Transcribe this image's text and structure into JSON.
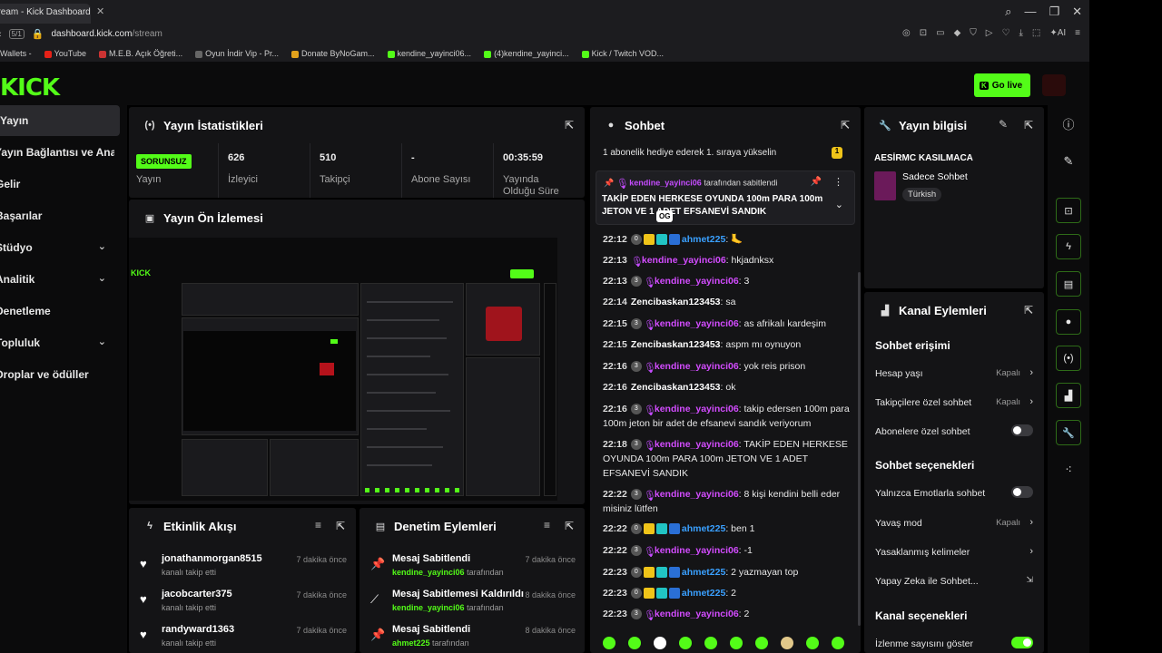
{
  "browser": {
    "tab_title": "Stream - Kick Dashboard",
    "url_host": "dashboard.kick.com",
    "url_path": "/stream",
    "bookmarks": [
      "Wallets -",
      "YouTube",
      "M.E.B. Açık Öğreti...",
      "Oyun İndir Vip - Pr...",
      "Donate ByNoGam...",
      "kendine_yayinci06...",
      "(4)kendine_yayinci...",
      "Kick / Twitch VOD..."
    ]
  },
  "header": {
    "logo": "KICK",
    "go_live_label": "Go live"
  },
  "sidebar": {
    "items": [
      {
        "label": "Yayın",
        "active": true
      },
      {
        "label": "Yayın Bağlantısı ve Anahtarı"
      },
      {
        "label": "Gelir"
      },
      {
        "label": "Başarılar"
      },
      {
        "label": "Stüdyo",
        "chevron": true
      },
      {
        "label": "Analitik",
        "chevron": true
      },
      {
        "label": "Denetleme"
      },
      {
        "label": "Topluluk",
        "chevron": true
      },
      {
        "label": "Droplar ve ödüller"
      }
    ]
  },
  "stats_panel": {
    "title": "Yayın İstatistikleri",
    "status_badge": "SORUNSUZ",
    "status_label": "Yayın",
    "viewers": {
      "value": "626",
      "label": "İzleyici"
    },
    "followers": {
      "value": "510",
      "label": "Takipçi"
    },
    "subs": {
      "value": "-",
      "label": "Abone Sayısı"
    },
    "duration": {
      "value": "00:35:59",
      "label": "Yayında Olduğu Süre"
    }
  },
  "preview_panel": {
    "title": "Yayın Ön İzlemesi"
  },
  "activity_panel": {
    "title": "Etkinlik Akışı",
    "items": [
      {
        "name": "jonathanmorgan8515",
        "action": "kanalı takip etti",
        "time": "7 dakika önce"
      },
      {
        "name": "jacobcarter375",
        "action": "kanalı takip etti",
        "time": "7 dakika önce"
      },
      {
        "name": "randyward1363",
        "action": "kanalı takip etti",
        "time": "7 dakika önce"
      }
    ]
  },
  "moderation_panel": {
    "title": "Denetim Eylemleri",
    "suffix": "tarafından",
    "items": [
      {
        "title": "Mesaj Sabitlendi",
        "by": "kendine_yayinci06",
        "time": "7 dakika önce"
      },
      {
        "title": "Mesaj Sabitlemesi Kaldırıldı",
        "by": "kendine_yayinci06",
        "time": "8 dakika önce"
      },
      {
        "title": "Mesaj Sabitlendi",
        "by": "ahmet225",
        "time": "8 dakika önce"
      }
    ]
  },
  "chat_panel": {
    "title": "Sohbet",
    "gift_text": "1 abonelik hediye ederek 1. sıraya yükselin",
    "gift_badge": "1",
    "pinned": {
      "by": "kendine_yayinci06",
      "by_suffix": "tarafından sabitlendi",
      "text": "TAKİP EDEN HERKESE OYUNDA 100m PARA 100m JETON VE 1 ADET EFSANEVİ SANDIK",
      "tooltip": "OG"
    },
    "messages": [
      {
        "time": "22:12",
        "user": "ahmet225",
        "color": "blue",
        "badges": true,
        "text": ""
      },
      {
        "time": "22:13",
        "user": "kendine_yayinci06",
        "color": "purple",
        "text": "hkjadnksx"
      },
      {
        "time": "22:13",
        "user": "kendine_yayinci06",
        "color": "purple",
        "circle": "3",
        "text": "3"
      },
      {
        "time": "22:14",
        "user": "Zencibaskan123453",
        "color": "white",
        "text": "sa"
      },
      {
        "time": "22:15",
        "user": "kendine_yayinci06",
        "color": "purple",
        "circle": "3",
        "text": "as afrikalı kardeşim"
      },
      {
        "time": "22:15",
        "user": "Zencibaskan123453",
        "color": "white",
        "text": "aspm mı oynuyon"
      },
      {
        "time": "22:16",
        "user": "kendine_yayinci06",
        "color": "purple",
        "circle": "3",
        "text": "yok reis prison"
      },
      {
        "time": "22:16",
        "user": "Zencibaskan123453",
        "color": "white",
        "text": "ok"
      },
      {
        "time": "22:16",
        "user": "kendine_yayinci06",
        "color": "purple",
        "circle": "3",
        "text": "takip edersen 100m para 100m jeton bir adet de efsanevi sandık veriyorum"
      },
      {
        "time": "22:18",
        "user": "kendine_yayinci06",
        "color": "purple",
        "circle": "3",
        "text": "TAKİP EDEN HERKESE OYUNDA 100m PARA 100m JETON VE 1 ADET EFSANEVİ SANDIK"
      },
      {
        "time": "22:22",
        "user": "kendine_yayinci06",
        "color": "purple",
        "circle": "3",
        "text": "8 kişi kendini belli eder misiniz lütfen"
      },
      {
        "time": "22:22",
        "user": "ahmet225",
        "color": "blue",
        "badges": true,
        "text": "ben 1"
      },
      {
        "time": "22:22",
        "user": "kendine_yayinci06",
        "color": "purple",
        "circle": "3",
        "text": "-1"
      },
      {
        "time": "22:23",
        "user": "ahmet225",
        "color": "blue",
        "badges": true,
        "text": "2 yazmayan top"
      },
      {
        "time": "22:23",
        "user": "ahmet225",
        "color": "blue",
        "badges": true,
        "text": "2"
      },
      {
        "time": "22:23",
        "user": "kendine_yayinci06",
        "color": "purple",
        "circle": "3",
        "text": "2"
      }
    ]
  },
  "info_panel": {
    "title": "Yayın bilgisi",
    "stream_title": "AESİRMC KASILMACA",
    "category": "Sadece Sohbet",
    "language": "Türkish"
  },
  "channel_actions": {
    "title": "Kanal Eylemleri",
    "chat_access_title": "Sohbet erişimi",
    "account_age": {
      "label": "Hesap yaşı",
      "value": "Kapalı"
    },
    "followers_only": {
      "label": "Takipçilere özel sohbet",
      "value": "Kapalı"
    },
    "subs_only": {
      "label": "Abonelere özel sohbet"
    },
    "chat_options_title": "Sohbet seçenekleri",
    "emote_only": {
      "label": "Yalnızca Emotlarla sohbet"
    },
    "slow_mode": {
      "label": "Yavaş mod",
      "value": "Kapalı"
    },
    "banned_words": {
      "label": "Yasaklanmış kelimeler"
    },
    "ai_chat": {
      "label": "Yapay Zeka ile Sohbet..."
    },
    "channel_options_title": "Kanal seçenekleri",
    "show_viewer_count": {
      "label": "İzlenme sayısını göster"
    }
  },
  "colors": {
    "accent": "#53fc18",
    "panel": "#141416",
    "background": "#000000"
  }
}
